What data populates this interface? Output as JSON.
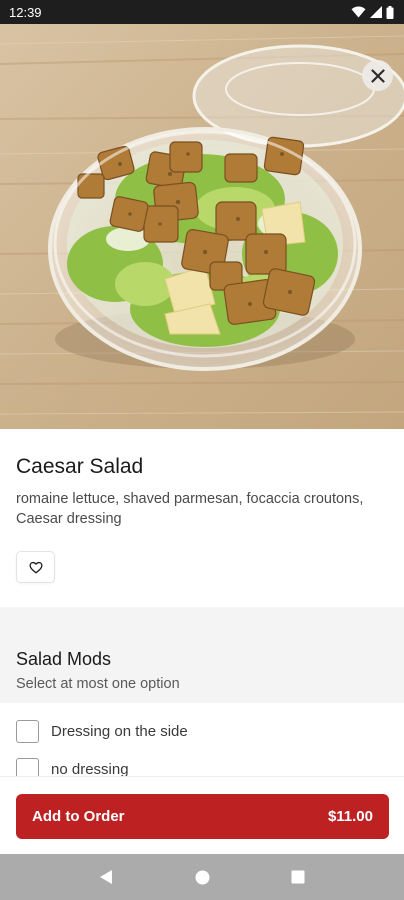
{
  "status_bar": {
    "time": "12:39",
    "icons": [
      "wifi-icon",
      "signal-icon",
      "battery-icon"
    ]
  },
  "hero": {
    "image": "caesar-salad-bowl-photo",
    "close_icon": "close-icon"
  },
  "item": {
    "title": "Caesar Salad",
    "description": "romaine lettuce, shaved parmesan, focaccia croutons, Caesar dressing",
    "favorite_icon": "heart-outline-icon"
  },
  "modifiers": {
    "title": "Salad Mods",
    "subtitle": "Select at most one option",
    "options": [
      {
        "label": "Dressing on the side",
        "checked": false
      },
      {
        "label": "no dressing",
        "checked": false
      }
    ]
  },
  "order": {
    "button_label": "Add to Order",
    "price": "$11.00",
    "accent": "#bd2122"
  },
  "nav": {
    "icons": [
      "back-icon",
      "home-icon",
      "recents-icon"
    ]
  }
}
